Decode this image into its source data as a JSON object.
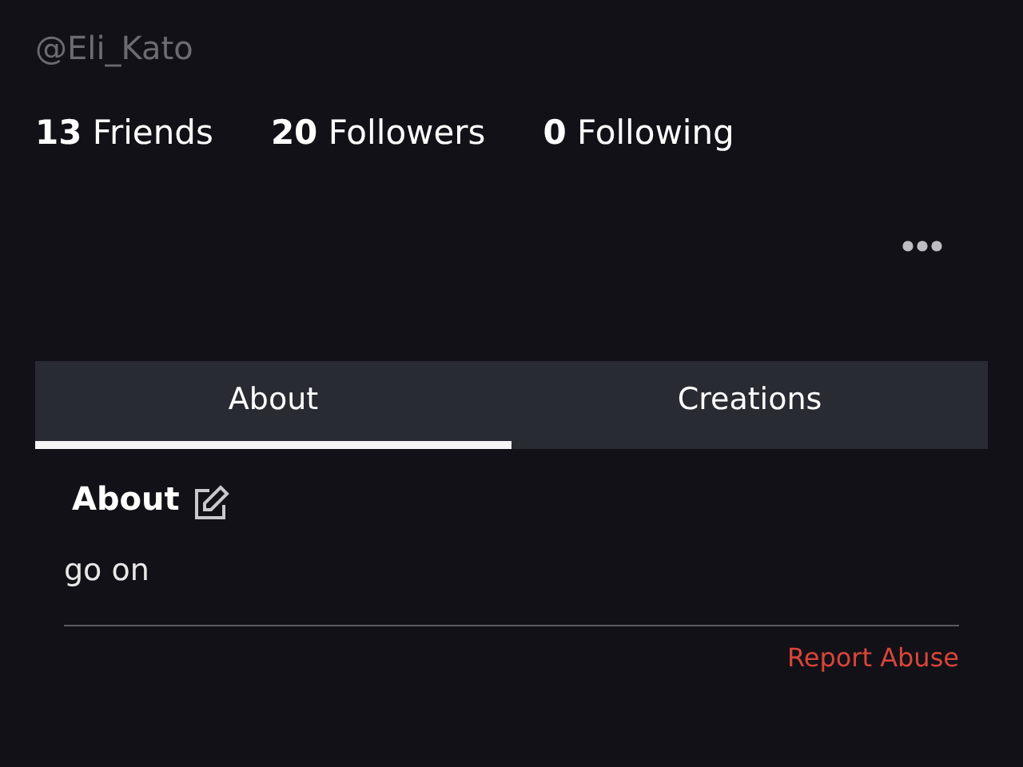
{
  "profile": {
    "handle": "@Eli_Kato",
    "stats": [
      {
        "count": "13",
        "label": "Friends"
      },
      {
        "count": "20",
        "label": "Followers"
      },
      {
        "count": "0",
        "label": "Following"
      }
    ]
  },
  "tabs": [
    {
      "label": "About",
      "selected": true
    },
    {
      "label": "Creations",
      "selected": false
    }
  ],
  "about": {
    "heading": "About",
    "text": "go on",
    "report_link": "Report Abuse"
  }
}
